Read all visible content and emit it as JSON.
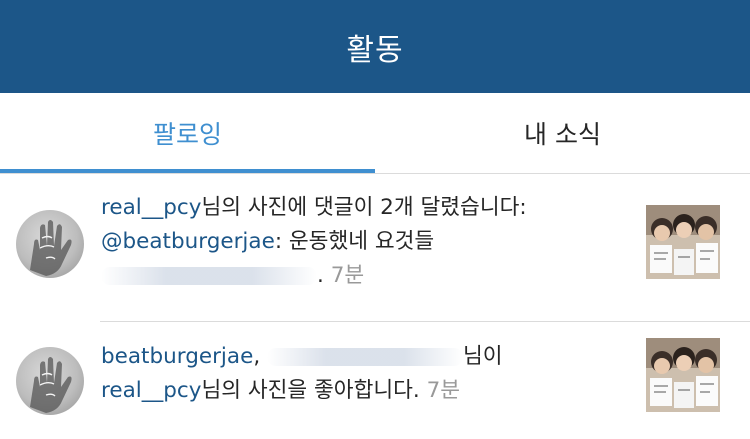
{
  "header": {
    "title": "활동"
  },
  "tabs": [
    {
      "label": "팔로잉",
      "active": true
    },
    {
      "label": "내 소식",
      "active": false
    }
  ],
  "colors": {
    "header_bg": "#1c5688",
    "accent": "#3f8fd0",
    "username": "#1c5688",
    "timestamp": "#999999"
  },
  "activities": [
    {
      "username": "real__pcy",
      "line1_text": "님의 사진에 댓글이 2개 달렸습니다:",
      "mention": "@beatburgerjae",
      "comment_text": ": 운동했네 요것들",
      "tail_text": ".",
      "time": "7분"
    },
    {
      "username": "beatburgerjae",
      "separator": ",",
      "line1_tail": "님이",
      "target_username": "real__pcy",
      "line2_text": "님의 사진을 좋아합니다.",
      "time": "7분"
    }
  ]
}
